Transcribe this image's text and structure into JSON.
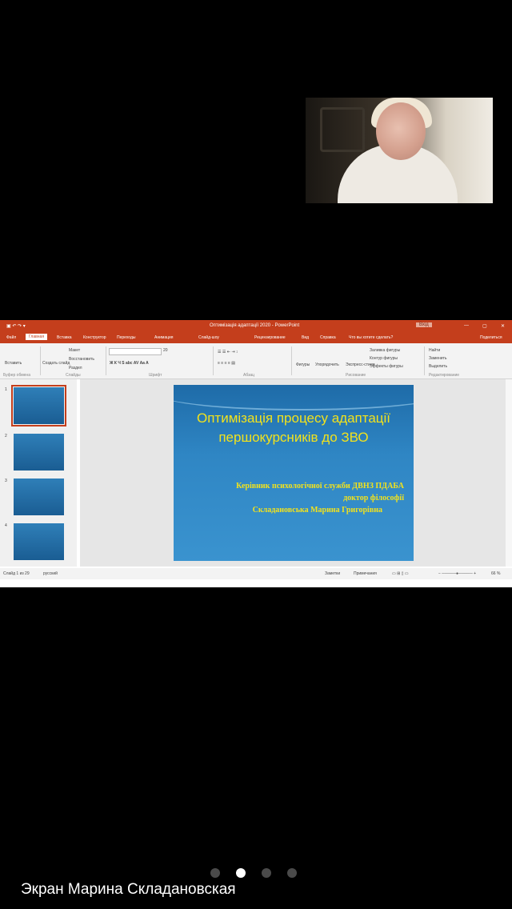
{
  "video_tile": {
    "participant": "Марина Складановская"
  },
  "powerpoint": {
    "window_title": "Оптимізація адаптації 2020 - PowerPoint",
    "sign_in": "Вхід",
    "share_label": "Поделиться",
    "tabs": [
      "Файл",
      "Главная",
      "Вставка",
      "Конструктор",
      "Переходы",
      "Анимация",
      "Слайд-шоу",
      "Рецензирование",
      "Вид",
      "Справка",
      "Что вы хотите сделать?"
    ],
    "active_tab": "Главная",
    "ribbon": {
      "paste": "Вставить",
      "create_slide": "Создать слайд",
      "layout": "Макет",
      "reset": "Восстановить",
      "section": "Раздел",
      "font_size": "20",
      "shapes": "Фигуры",
      "arrange": "Упорядочить",
      "quick_styles": "Экспресс-стили",
      "fill": "Заливка фигуры",
      "outline": "Контур фигуры",
      "effects": "Эффекты фигуры",
      "find": "Найти",
      "replace": "Заменить",
      "select": "Выделить",
      "group_clipboard": "Буфер обмена",
      "group_slides": "Слайды",
      "group_font": "Шрифт",
      "group_paragraph": "Абзац",
      "group_drawing": "Рисование",
      "group_editing": "Редактирование"
    },
    "thumbnails": [
      "1",
      "2",
      "3",
      "4"
    ],
    "slide": {
      "title": "Оптимізація процесу адаптації першокурсників до ЗВО",
      "subtitle_lines": [
        "Керівник психологічної служби ДВНЗ ПДАБА",
        "доктор філософії",
        "Складановська Марина Григорівна"
      ]
    },
    "status": {
      "slide_counter": "Слайд 1 из 29",
      "language": "русский",
      "notes": "Заметки",
      "comments": "Примечания",
      "zoom": "66 %"
    }
  },
  "pager": {
    "count": 4,
    "active_index": 1
  },
  "caption": "Экран Марина Складановская",
  "colors": {
    "accent": "#c43e1c",
    "slide_text": "#f2e21c",
    "background": "#000000"
  }
}
